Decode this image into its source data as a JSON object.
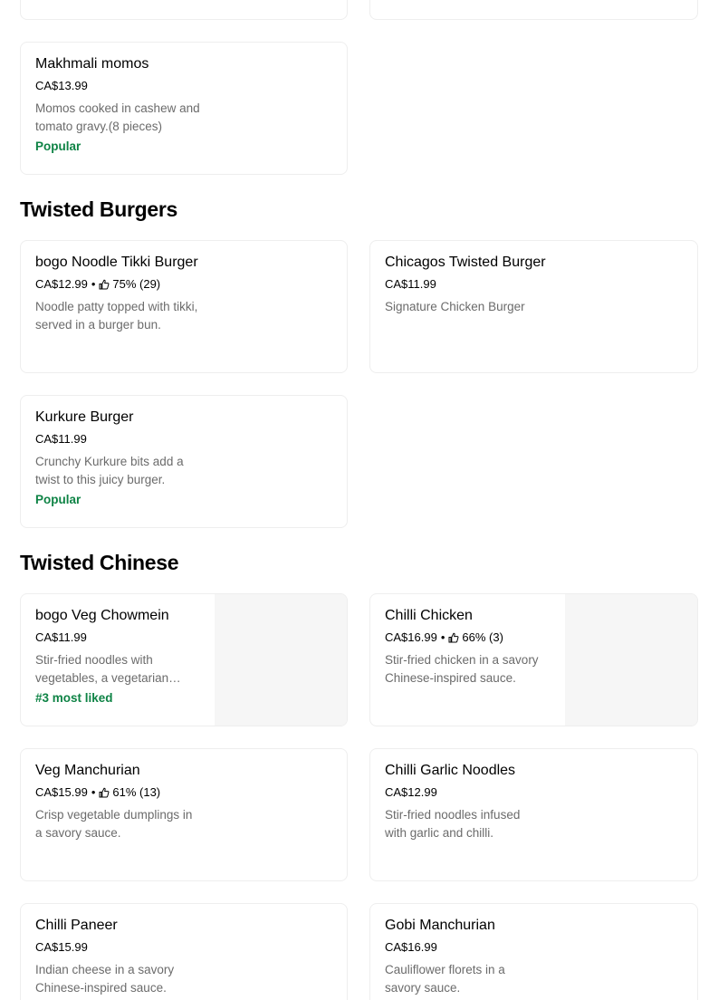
{
  "sections": {
    "twisted_burgers": {
      "title": "Twisted Burgers"
    },
    "twisted_chinese": {
      "title": "Twisted Chinese"
    }
  },
  "items": {
    "makhmali_momos": {
      "name": "Makhmali momos",
      "price": "CA$13.99",
      "description": "Momos cooked in cashew and tomato gravy.(8 pieces)",
      "tag": "Popular"
    },
    "bogo_noodle_tikki": {
      "name": "bogo Noodle Tikki Burger",
      "price": "CA$12.99",
      "separator": "•",
      "rating": "75% (29)",
      "description": "Noodle patty topped with tikki, served in a burger bun."
    },
    "chicagos_twisted": {
      "name": "Chicagos Twisted Burger",
      "price": "CA$11.99",
      "description": "Signature Chicken Burger"
    },
    "kurkure_burger": {
      "name": "Kurkure Burger",
      "price": "CA$11.99",
      "description": "Crunchy Kurkure bits add a twist to this juicy burger.",
      "tag": "Popular"
    },
    "bogo_veg_chowmein": {
      "name": "bogo Veg Chowmein",
      "price": "CA$11.99",
      "description": "Stir-fried noodles with vegetables, a vegetarian delight.",
      "tag": "#3 most liked"
    },
    "chilli_chicken": {
      "name": "Chilli Chicken",
      "price": "CA$16.99",
      "separator": "•",
      "rating": "66% (3)",
      "description": "Stir-fried chicken in a savory Chinese-inspired sauce."
    },
    "veg_manchurian": {
      "name": "Veg Manchurian",
      "price": "CA$15.99",
      "separator": "•",
      "rating": "61% (13)",
      "description": "Crisp vegetable dumplings in a savory sauce."
    },
    "chilli_garlic_noodles": {
      "name": "Chilli Garlic Noodles",
      "price": "CA$12.99",
      "description": "Stir-fried noodles infused with garlic and chilli."
    },
    "chilli_paneer": {
      "name": "Chilli Paneer",
      "price": "CA$15.99",
      "description": "Indian cheese in a savory Chinese-inspired sauce."
    },
    "gobi_manchurian": {
      "name": "Gobi Manchurian",
      "price": "CA$16.99",
      "description": "Cauliflower florets in a savory sauce."
    }
  },
  "colors": {
    "tag_green": "#0e8345",
    "description_gray": "#6b6b6b",
    "card_border": "#eeeeee",
    "image_placeholder": "#f6f6f6"
  },
  "icons": {
    "rating": "thumbs-up-icon"
  }
}
